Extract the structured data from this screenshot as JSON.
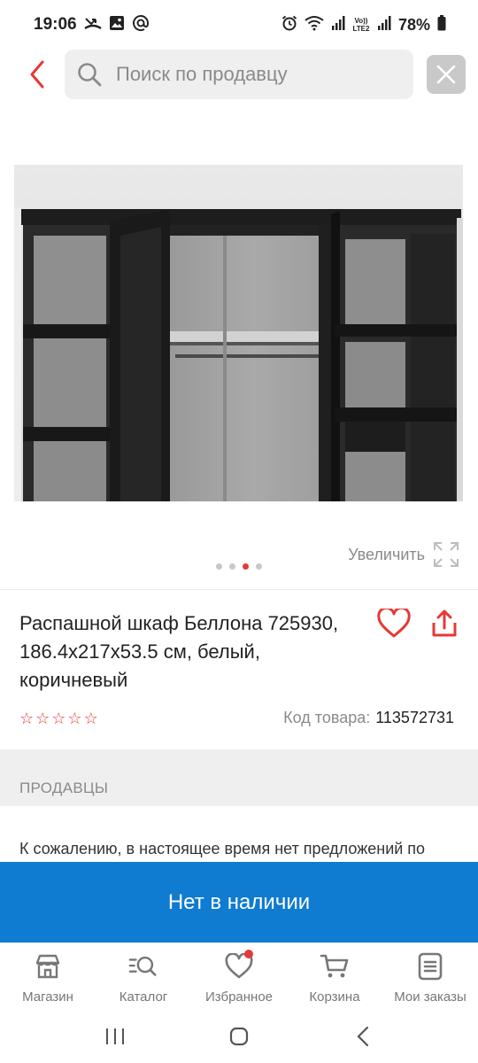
{
  "status_bar": {
    "time": "19:06",
    "battery": "78%",
    "network_label": "Vo)) LTE2",
    "icons": [
      "missed-call-icon",
      "gallery-icon",
      "at-icon",
      "alarm-icon",
      "wifi-icon",
      "signal-icon",
      "battery-icon"
    ]
  },
  "top_bar": {
    "back_icon": "chevron-left-icon",
    "search_placeholder": "Поиск по продавцу",
    "search_value": "",
    "close_icon": "close-icon"
  },
  "gallery": {
    "image_count": 4,
    "active_index": 2,
    "zoom_label": "Увеличить",
    "zoom_icon": "expand-icon"
  },
  "product": {
    "title": "Распашной шкаф Беллона 725930, 186.4x217x53.5 см, белый, коричневый",
    "rating": 0,
    "rating_max": 5,
    "sku_label": "Код товара:",
    "sku_value": "113572731",
    "favorite_icon": "heart-icon",
    "share_icon": "share-icon"
  },
  "sellers": {
    "header": "ПРОДАВЦЫ",
    "notice": "К сожалению, в настоящее время нет предложений по"
  },
  "cta": {
    "label": "Нет в наличии"
  },
  "bottom_nav": {
    "items": [
      {
        "label": "Магазин",
        "icon": "store-icon"
      },
      {
        "label": "Каталог",
        "icon": "catalog-search-icon"
      },
      {
        "label": "Избранное",
        "icon": "heart-icon",
        "badge": true
      },
      {
        "label": "Корзина",
        "icon": "cart-icon"
      },
      {
        "label": "Мои заказы",
        "icon": "orders-icon"
      }
    ]
  },
  "colors": {
    "accent_red": "#e53935",
    "cta_blue": "#0f7bd1",
    "muted_text": "#8a8a8a"
  }
}
